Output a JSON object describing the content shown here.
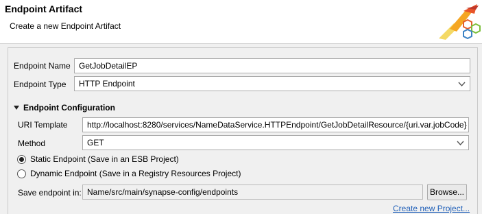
{
  "wizard": {
    "title": "Endpoint Artifact",
    "subtitle": "Create a new Endpoint Artifact",
    "banner_icon": "wizard-banner-icon"
  },
  "form": {
    "endpoint_name": {
      "label": "Endpoint Name",
      "value": "GetJobDetailEP"
    },
    "endpoint_type": {
      "label": "Endpoint Type",
      "value": "HTTP Endpoint"
    },
    "section": {
      "label": "Endpoint Configuration",
      "expanded": true
    },
    "uri_template": {
      "label": "URI Template",
      "value": "http://localhost:8280/services/NameDataService.HTTPEndpoint/GetJobDetailResource/{uri.var.jobCode}"
    },
    "method": {
      "label": "Method",
      "value": "GET"
    },
    "static_endpoint": {
      "label": "Static Endpoint (Save in an ESB Project)",
      "selected": true
    },
    "dynamic_endpoint": {
      "label": "Dynamic Endpoint (Save in a Registry Resources Project)",
      "selected": false
    },
    "save_in": {
      "label": "Save endpoint in:",
      "value": "Name/src/main/synapse-config/endpoints"
    },
    "browse_label": "Browse...",
    "create_project_link": "Create new Project..."
  },
  "colors": {
    "link": "#1f5fb8",
    "header_bg": "#ffffff",
    "panel_bg": "#f0f0f0"
  }
}
